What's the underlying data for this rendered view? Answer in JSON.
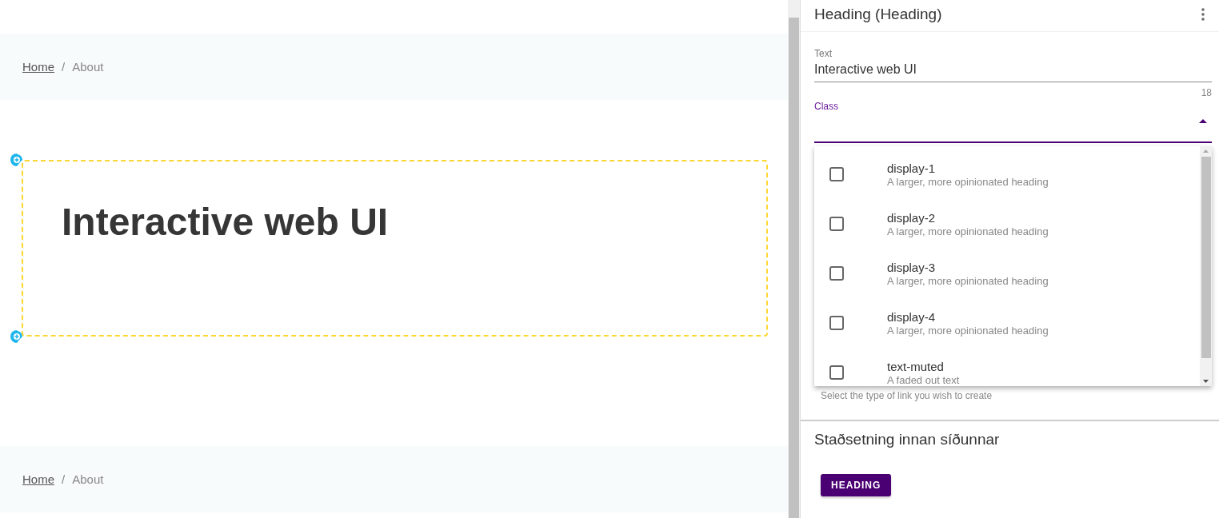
{
  "breadcrumbs_top": {
    "items": [
      {
        "label": "Home",
        "kind": "link"
      },
      {
        "label": "About",
        "kind": "current"
      }
    ],
    "separator": "/"
  },
  "heading_block": {
    "text": "Interactive web UI",
    "selected": true
  },
  "breadcrumbs_bottom": {
    "items": [
      {
        "label": "Home",
        "kind": "link"
      },
      {
        "label": "About",
        "kind": "current"
      }
    ],
    "separator": "/"
  },
  "panel": {
    "title": "Heading (Heading)",
    "text_field": {
      "label": "Text",
      "value": "Interactive web UI",
      "counter": "18"
    },
    "class_field": {
      "label": "Class",
      "expanded": true,
      "hint": "Select the type of link you wish to create",
      "options": [
        {
          "name": "display-1",
          "description": "A larger, more opinionated heading",
          "checked": false
        },
        {
          "name": "display-2",
          "description": "A larger, more opinionated heading",
          "checked": false
        },
        {
          "name": "display-3",
          "description": "A larger, more opinionated heading",
          "checked": false
        },
        {
          "name": "display-4",
          "description": "A larger, more opinionated heading",
          "checked": false
        },
        {
          "name": "text-muted",
          "description": "A faded out text",
          "checked": false
        }
      ]
    },
    "section_title": "Staðsetning innan síðunnar",
    "button": "HEADING"
  }
}
